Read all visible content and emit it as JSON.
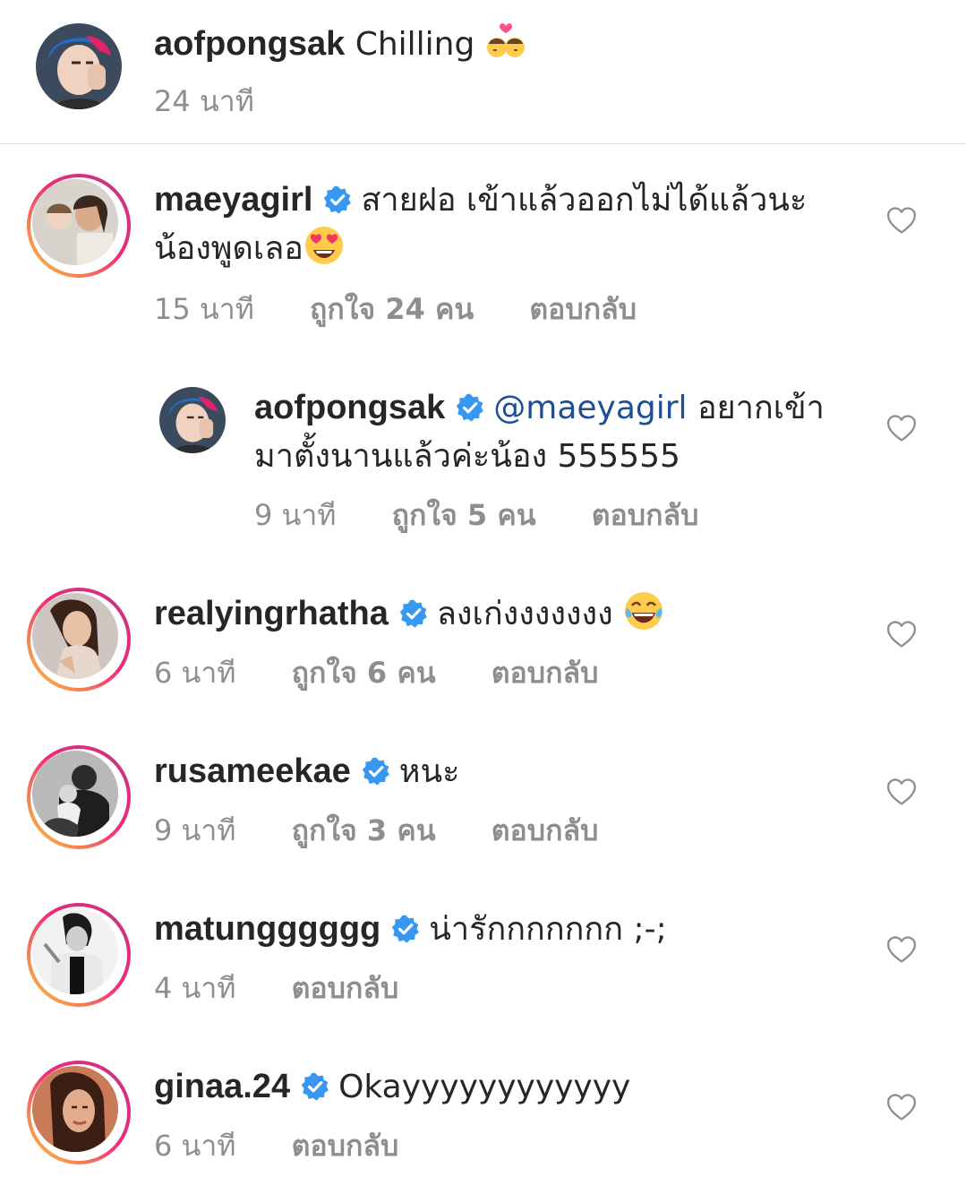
{
  "caption": {
    "username": "aofpongsak",
    "text": "Chilling",
    "emoji": "kiss-couple-emoji",
    "time": "24 นาที"
  },
  "comments": [
    {
      "username": "maeyagirl",
      "verified": true,
      "text_line1": "สายฝอ เข้าแล้วออกไม่ได้แล้วนะ",
      "text_line2": "น้องพูดเลอ",
      "emoji": "heart-eyes-emoji",
      "time": "15 นาที",
      "likes": "ถูกใจ 24 คน",
      "reply": "ตอบกลับ"
    },
    {
      "username": "aofpongsak",
      "verified": true,
      "mention": "@maeyagirl",
      "text_line1": "อยากเข้า",
      "text_line2": "มาตั้งนานแล้วค่ะน้อง 555555",
      "time": "9 นาที",
      "likes": "ถูกใจ 5 คน",
      "reply": "ตอบกลับ"
    },
    {
      "username": "realyingrhatha",
      "verified": true,
      "text": "ลงเก่งงงงงงง",
      "emoji": "tears-of-joy-emoji",
      "time": "6 นาที",
      "likes": "ถูกใจ 6 คน",
      "reply": "ตอบกลับ"
    },
    {
      "username": "rusameekae",
      "verified": true,
      "text": "หนะ",
      "time": "9 นาที",
      "likes": "ถูกใจ 3 คน",
      "reply": "ตอบกลับ"
    },
    {
      "username": "matungggggg",
      "verified": true,
      "text": "น่ารักกกกกกก ;-;",
      "time": "4 นาที",
      "reply": "ตอบกลับ"
    },
    {
      "username": "ginaa.24",
      "verified": true,
      "text": "Okayyyyyyyyyyyy",
      "time": "6 นาที",
      "reply": "ตอบกลับ"
    }
  ],
  "colors": {
    "text": "#262626",
    "meta": "#8e8e8e",
    "verified": "#3897f0",
    "mention": "#1e4f93",
    "divider": "#dbdbdb"
  }
}
